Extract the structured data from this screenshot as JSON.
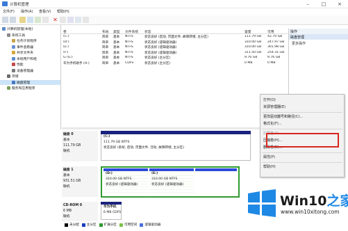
{
  "window": {
    "title": "计算机管理"
  },
  "menubar": [
    "文件(F)",
    "操作(A)",
    "查看(V)",
    "帮助(H)"
  ],
  "tree": [
    {
      "label": "计算机管理(本地)",
      "level": 0
    },
    {
      "label": "系统工具",
      "level": 1
    },
    {
      "label": "任务计划程序",
      "level": 2
    },
    {
      "label": "事件查看器",
      "level": 2
    },
    {
      "label": "共享文件夹",
      "level": 2
    },
    {
      "label": "本地用户和组",
      "level": 2
    },
    {
      "label": "性能",
      "level": 2
    },
    {
      "label": "设备管理器",
      "level": 2
    },
    {
      "label": "存储",
      "level": 1
    },
    {
      "label": "磁盘管理",
      "level": 2,
      "selected": true
    },
    {
      "label": "服务和应用程序",
      "level": 1
    }
  ],
  "volumes": {
    "headers": [
      "卷",
      "布局",
      "类型",
      "文件系统",
      "状态",
      "容量",
      "可用"
    ],
    "rows": [
      [
        "(C:)",
        "简单",
        "基本",
        "NTFS",
        "状态良好 (启动, 页面文件, 故障转储, 主分区)",
        "111.79 GB",
        "42.70 GB"
      ],
      [
        "(D:)",
        "简单",
        "基本",
        "NTFS",
        "状态良好 (逻辑驱动器)",
        "310.00 GB",
        "247.97 GB"
      ],
      [
        "(E:)",
        "简单",
        "基本",
        "NTFS",
        "状态良好 (逻辑驱动器)",
        "310.00 GB",
        "301.98 GB"
      ],
      [
        "(F:)",
        "简单",
        "基本",
        "NTFS",
        "状态良好 (逻辑驱动器)",
        "311.50 GB",
        "254.31 GB"
      ],
      [
        "G (G:)",
        "简单",
        "基本",
        "NTFS",
        "状态良好 (主分区)",
        "9.76 GB",
        "9.76 GB"
      ],
      [
        "华为手机助手 (H:)",
        "简单",
        "基本",
        "CDFS",
        "状态良好 (主分区)",
        "0 MB",
        "0 MB"
      ]
    ]
  },
  "actions": {
    "title": "操作",
    "subtitle": "磁盘管理",
    "more": "更多操作"
  },
  "disks": [
    {
      "name": "磁盘 0",
      "type": "基本",
      "size": "111.79 GB",
      "status": "联机",
      "partitions": [
        {
          "label": "(C:)",
          "size": "111.79 GB NTFS",
          "status": "状态良好 (系统, 启动, 页面文件, 活动, 故障转储, 主分区)"
        }
      ]
    },
    {
      "name": "磁盘 1",
      "type": "基本",
      "size": "931.51 GB",
      "status": "联机",
      "partitions": [
        {
          "label": "(D:)",
          "size": "310.00 GB NTFS",
          "status": "状态良好 (逻辑驱动器)"
        },
        {
          "label": "(E:)",
          "size": "310.00 GB NTFS",
          "status": "状态良好 (逻辑驱动器)"
        }
      ]
    },
    {
      "name": "CD-ROM 0",
      "type": "CD-ROM",
      "size": "6 MB",
      "status": "联机",
      "partitions": [
        {
          "label": "华为手机",
          "size": "6 MB CDFS",
          "status": "状态良好"
        }
      ]
    }
  ],
  "context_menu": [
    {
      "label": "打开(O)",
      "disabled": false
    },
    {
      "label": "资源管理器(E)",
      "disabled": false
    },
    {
      "sep": true
    },
    {
      "label": "更改驱动器号和路径(C)...",
      "disabled": false
    },
    {
      "label": "格式化(F)...",
      "disabled": false
    },
    {
      "sep": true
    },
    {
      "label": "扩展卷(X)...",
      "disabled": true
    },
    {
      "label": "压缩卷(H)...",
      "disabled": false,
      "highlight": true
    },
    {
      "label": "删除卷(D)...",
      "disabled": false
    },
    {
      "sep": true
    },
    {
      "label": "属性(P)",
      "disabled": false
    },
    {
      "sep": true
    },
    {
      "label": "帮助(H)",
      "disabled": false
    }
  ],
  "legend": [
    {
      "label": "未分配",
      "color": "#000000"
    },
    {
      "label": "主分区",
      "color": "#1a3dbd"
    },
    {
      "label": "扩展分区",
      "color": "#2f9a2f"
    },
    {
      "label": "可用空间",
      "color": "#7cc24a"
    },
    {
      "label": "逻辑驱动器",
      "color": "#4a6fe0"
    }
  ],
  "watermark": {
    "brand_prefix": "Win10",
    "brand_suffix": "之家",
    "url": "www.win10xitong.com"
  },
  "colors": {
    "primary_bar": "#1a237e",
    "logical_bar": "#2a4ad8",
    "extended_border": "#2f9a2f",
    "highlight_box": "#d6261c",
    "win_blue": "#1e88e5"
  }
}
